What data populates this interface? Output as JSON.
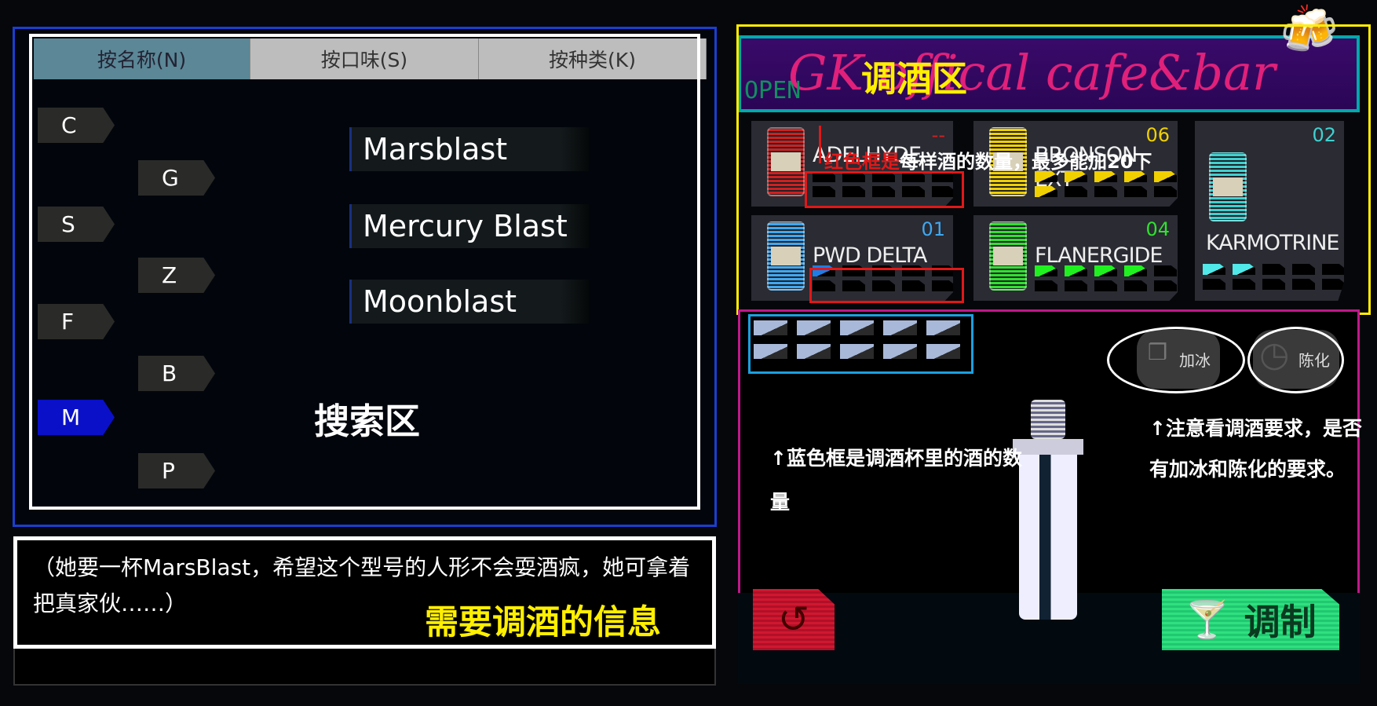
{
  "search_panel": {
    "tabs": [
      {
        "label": "按名称(N)",
        "active": true
      },
      {
        "label": "按口味(S)",
        "active": false
      },
      {
        "label": "按种类(K)",
        "active": false
      }
    ],
    "letters": [
      {
        "label": "C"
      },
      {
        "label": "G"
      },
      {
        "label": "S"
      },
      {
        "label": "Z"
      },
      {
        "label": "F"
      },
      {
        "label": "B"
      },
      {
        "label": "M",
        "selected": true
      },
      {
        "label": "P"
      }
    ],
    "drinks": [
      "Marsblast",
      "Mercury Blast",
      "Moonblast"
    ],
    "annotation": "搜索区"
  },
  "message": {
    "text": "（她要一杯MarsBlast，希望这个型号的人形不会耍酒疯，她可拿着把真家伙……）",
    "annotation": "需要调酒的信息"
  },
  "mix_zone": {
    "annotation": "调酒区",
    "banner_text": "GK offical cafe&bar",
    "open_sign": "OPEN",
    "ingredients": [
      {
        "name": "ADELHYDE",
        "count": "--",
        "filled": 0,
        "color": "#d02020",
        "slot_color": "#d02020"
      },
      {
        "name": "BRONSON EXT",
        "count": "06",
        "filled": 6,
        "color": "#f0d000",
        "slot_color": "#f0d000"
      },
      {
        "name": "PWD DELTA",
        "count": "01",
        "filled": 1,
        "color": "#40a8f0",
        "slot_color": "#1e7ee8"
      },
      {
        "name": "FLANERGIDE",
        "count": "04",
        "filled": 4,
        "color": "#30e030",
        "slot_color": "#20f020"
      },
      {
        "name": "KARMOTRINE",
        "count": "02",
        "filled": 2,
        "color": "#40d0d0",
        "slot_color": "#50e8e8"
      }
    ],
    "red_note_red": "红色框是",
    "red_note_white": "每样酒的数量，最多能加20下"
  },
  "stage": {
    "glass_slots": 10,
    "glass_note": "↑蓝色框是调酒杯里的酒的数量",
    "ice_label": "加冰",
    "age_label": "陈化",
    "req_note": "↑注意看调酒要求，是否有加冰和陈化的要求。",
    "mix_label": "调制"
  }
}
